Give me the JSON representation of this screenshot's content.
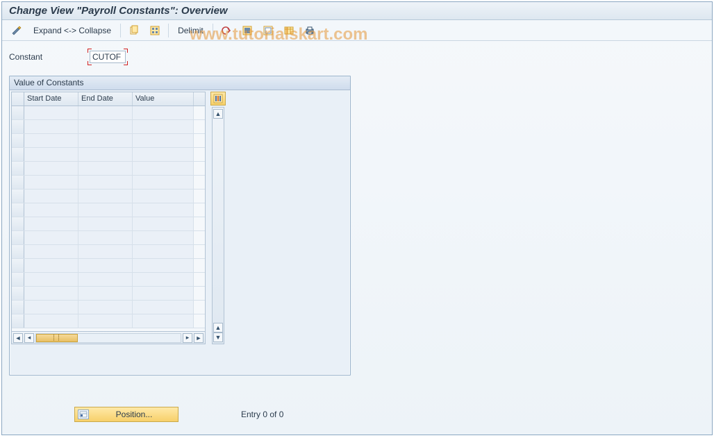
{
  "title": "Change View \"Payroll Constants\": Overview",
  "watermark": "www.tutorialskart.com",
  "toolbar": {
    "expand_collapse": "Expand <-> Collapse",
    "delimit": "Delimit"
  },
  "field": {
    "label": "Constant",
    "value": "CUTOF"
  },
  "panel": {
    "title": "Value of Constants",
    "columns": {
      "start": "Start Date",
      "end": "End Date",
      "value": "Value"
    },
    "rows": [
      {
        "start": "",
        "end": "",
        "value": ""
      },
      {
        "start": "",
        "end": "",
        "value": ""
      },
      {
        "start": "",
        "end": "",
        "value": ""
      },
      {
        "start": "",
        "end": "",
        "value": ""
      },
      {
        "start": "",
        "end": "",
        "value": ""
      },
      {
        "start": "",
        "end": "",
        "value": ""
      },
      {
        "start": "",
        "end": "",
        "value": ""
      },
      {
        "start": "",
        "end": "",
        "value": ""
      },
      {
        "start": "",
        "end": "",
        "value": ""
      },
      {
        "start": "",
        "end": "",
        "value": ""
      },
      {
        "start": "",
        "end": "",
        "value": ""
      },
      {
        "start": "",
        "end": "",
        "value": ""
      },
      {
        "start": "",
        "end": "",
        "value": ""
      },
      {
        "start": "",
        "end": "",
        "value": ""
      },
      {
        "start": "",
        "end": "",
        "value": ""
      },
      {
        "start": "",
        "end": "",
        "value": ""
      }
    ]
  },
  "position_btn": "Position...",
  "entry_txt": "Entry 0 of 0"
}
